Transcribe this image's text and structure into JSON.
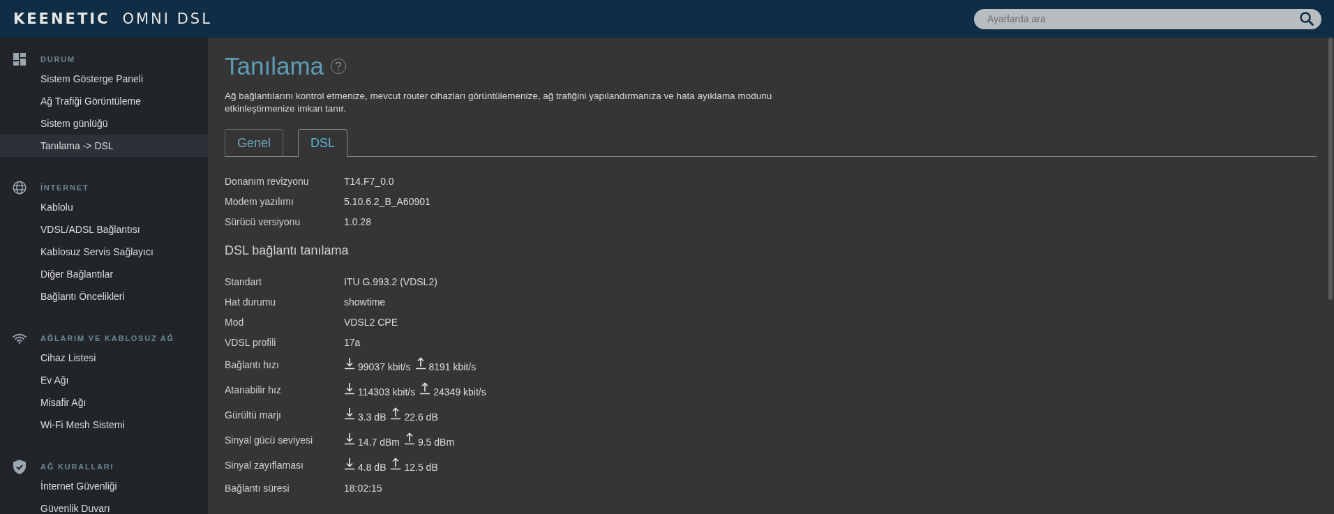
{
  "header": {
    "logo_brand": "KEENETIC",
    "logo_model": "OMNI DSL",
    "search": {
      "placeholder": "Ayarlarda ara"
    }
  },
  "sidebar": {
    "sections": [
      {
        "title": "DURUM",
        "items": [
          {
            "label": "Sistem Gösterge Paneli",
            "selected": false
          },
          {
            "label": "Ağ Trafiği Görüntüleme",
            "selected": false
          },
          {
            "label": "Sistem günlüğü",
            "selected": false
          },
          {
            "label": "Tanılama -> DSL",
            "selected": true
          }
        ]
      },
      {
        "title": "İNTERNET",
        "items": [
          {
            "label": "Kablolu",
            "selected": false
          },
          {
            "label": "VDSL/ADSL Bağlantısı",
            "selected": false
          },
          {
            "label": "Kablosuz Servis Sağlayıcı",
            "selected": false
          },
          {
            "label": "Diğer Bağlantılar",
            "selected": false
          },
          {
            "label": "Bağlantı Öncelikleri",
            "selected": false
          }
        ]
      },
      {
        "title": "AĞLARIM VE KABLOSUZ AĞ",
        "items": [
          {
            "label": "Cihaz Listesi",
            "selected": false
          },
          {
            "label": "Ev Ağı",
            "selected": false
          },
          {
            "label": "Misafir Ağı",
            "selected": false
          },
          {
            "label": "Wi-Fi Mesh Sistemi",
            "selected": false
          }
        ]
      },
      {
        "title": "AĞ KURALLARI",
        "items": [
          {
            "label": "İnternet Güvenliği",
            "selected": false
          },
          {
            "label": "Güvenlik Duvarı",
            "selected": false
          }
        ]
      }
    ]
  },
  "page": {
    "title": "Tanılama",
    "description": "Ağ bağlantılarını kontrol etmenize, mevcut router cihazları görüntülemenize, ağ trafiğini yapılandırmanıza ve hata ayıklama modunu etkinleştirmenize imkan tanır.",
    "tabs": [
      {
        "label": "Genel",
        "selected": false
      },
      {
        "label": "DSL",
        "selected": true
      }
    ],
    "device_info": [
      {
        "label": "Donanım revizyonu",
        "value": "T14.F7_0.0"
      },
      {
        "label": "Modem yazılımı",
        "value": "5.10.6.2_B_A60901"
      },
      {
        "label": "Sürücü versiyonu",
        "value": "1.0.28"
      }
    ],
    "section_title": "DSL bağlantı tanılama",
    "diagnostics": [
      {
        "kind": "text",
        "label": "Standart",
        "value": "ITU G.993.2 (VDSL2)"
      },
      {
        "kind": "text",
        "label": "Hat durumu",
        "value": "showtime"
      },
      {
        "kind": "text",
        "label": "Mod",
        "value": "VDSL2 CPE"
      },
      {
        "kind": "text",
        "label": "VDSL profili",
        "value": "17a"
      },
      {
        "kind": "updown",
        "label": "Bağlantı hızı",
        "down": "99037 kbit/s",
        "up": "8191 kbit/s"
      },
      {
        "kind": "updown",
        "label": "Atanabilir hız",
        "down": "114303 kbit/s",
        "up": "24349 kbit/s"
      },
      {
        "kind": "updown",
        "label": "Gürültü marjı",
        "down": "3.3 dB",
        "up": "22.6 dB"
      },
      {
        "kind": "updown",
        "label": "Sinyal gücü seviyesi",
        "down": "14.7 dBm",
        "up": "9.5 dBm"
      },
      {
        "kind": "updown",
        "label": "Sinyal zayıflaması",
        "down": "4.8 dB",
        "up": "12.5 dB"
      },
      {
        "kind": "text",
        "label": "Bağlantı süresi",
        "value": "18:02:15"
      }
    ]
  }
}
